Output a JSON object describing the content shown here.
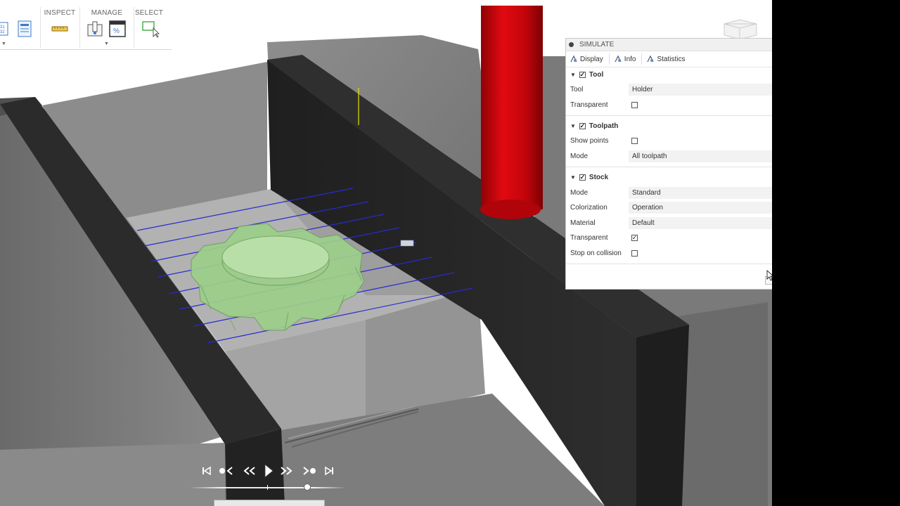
{
  "toolbar": {
    "inspect_label": "INSPECT",
    "manage_label": "MANAGE",
    "select_label": "SELECT"
  },
  "panel": {
    "title": "SIMULATE",
    "tabs": [
      {
        "label": "Display",
        "icon": "display-icon"
      },
      {
        "label": "Info",
        "icon": "info-icon"
      },
      {
        "label": "Statistics",
        "icon": "statistics-icon"
      }
    ],
    "tool": {
      "header": "Tool",
      "enabled": true,
      "tool_label": "Tool",
      "tool_value": "Holder",
      "transparent_label": "Transparent",
      "transparent_checked": false
    },
    "toolpath": {
      "header": "Toolpath",
      "enabled": true,
      "show_points_label": "Show points",
      "show_points_checked": false,
      "mode_label": "Mode",
      "mode_value": "All toolpath"
    },
    "stock": {
      "header": "Stock",
      "enabled": true,
      "mode_label": "Mode",
      "mode_value": "Standard",
      "colorization_label": "Colorization",
      "colorization_value": "Operation",
      "material_label": "Material",
      "material_value": "Default",
      "transparent_label": "Transparent",
      "transparent_checked": true,
      "stop_on_collision_label": "Stop on collision",
      "stop_on_collision_checked": false
    }
  },
  "playback": {
    "buttons": [
      "go-to-start-icon",
      "previous-operation-icon",
      "step-back-icon",
      "play-icon",
      "step-forward-icon",
      "next-operation-icon",
      "go-to-end-icon"
    ],
    "progress": 0.75
  },
  "colors": {
    "tool": "#c8040a",
    "part": "#9ccf8a",
    "toolpath": "#2a2ad0",
    "vise": "#2a2a2a"
  }
}
